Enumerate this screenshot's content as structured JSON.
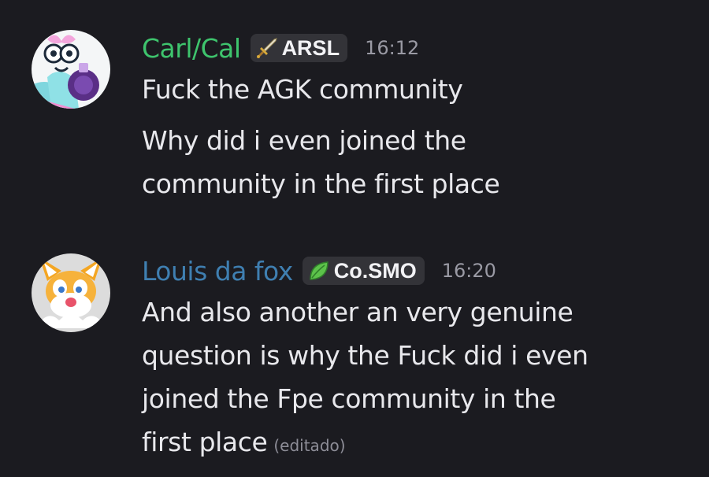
{
  "colors": {
    "background": "#1b1b20",
    "username_1": "#3ec46d",
    "username_2": "#3f7fb1",
    "tag_bg": "#333338",
    "timestamp": "#9a9aa4"
  },
  "messages": [
    {
      "username": "Carl/Cal",
      "tag": {
        "icon": "sword-icon",
        "label": "ARSL"
      },
      "timestamp": "16:12",
      "lines": [
        "Fuck the AGK community",
        "Why did i even joined the",
        "community in the first place"
      ]
    },
    {
      "username": "Louis da fox",
      "tag": {
        "icon": "leaf-icon",
        "label": "Co.SMO"
      },
      "timestamp": "16:20",
      "lines": [
        "And also another an very genuine",
        "question is why the Fuck did i even",
        "joined the Fpe community in the",
        "first place"
      ],
      "edited_label": "(editado)"
    }
  ]
}
